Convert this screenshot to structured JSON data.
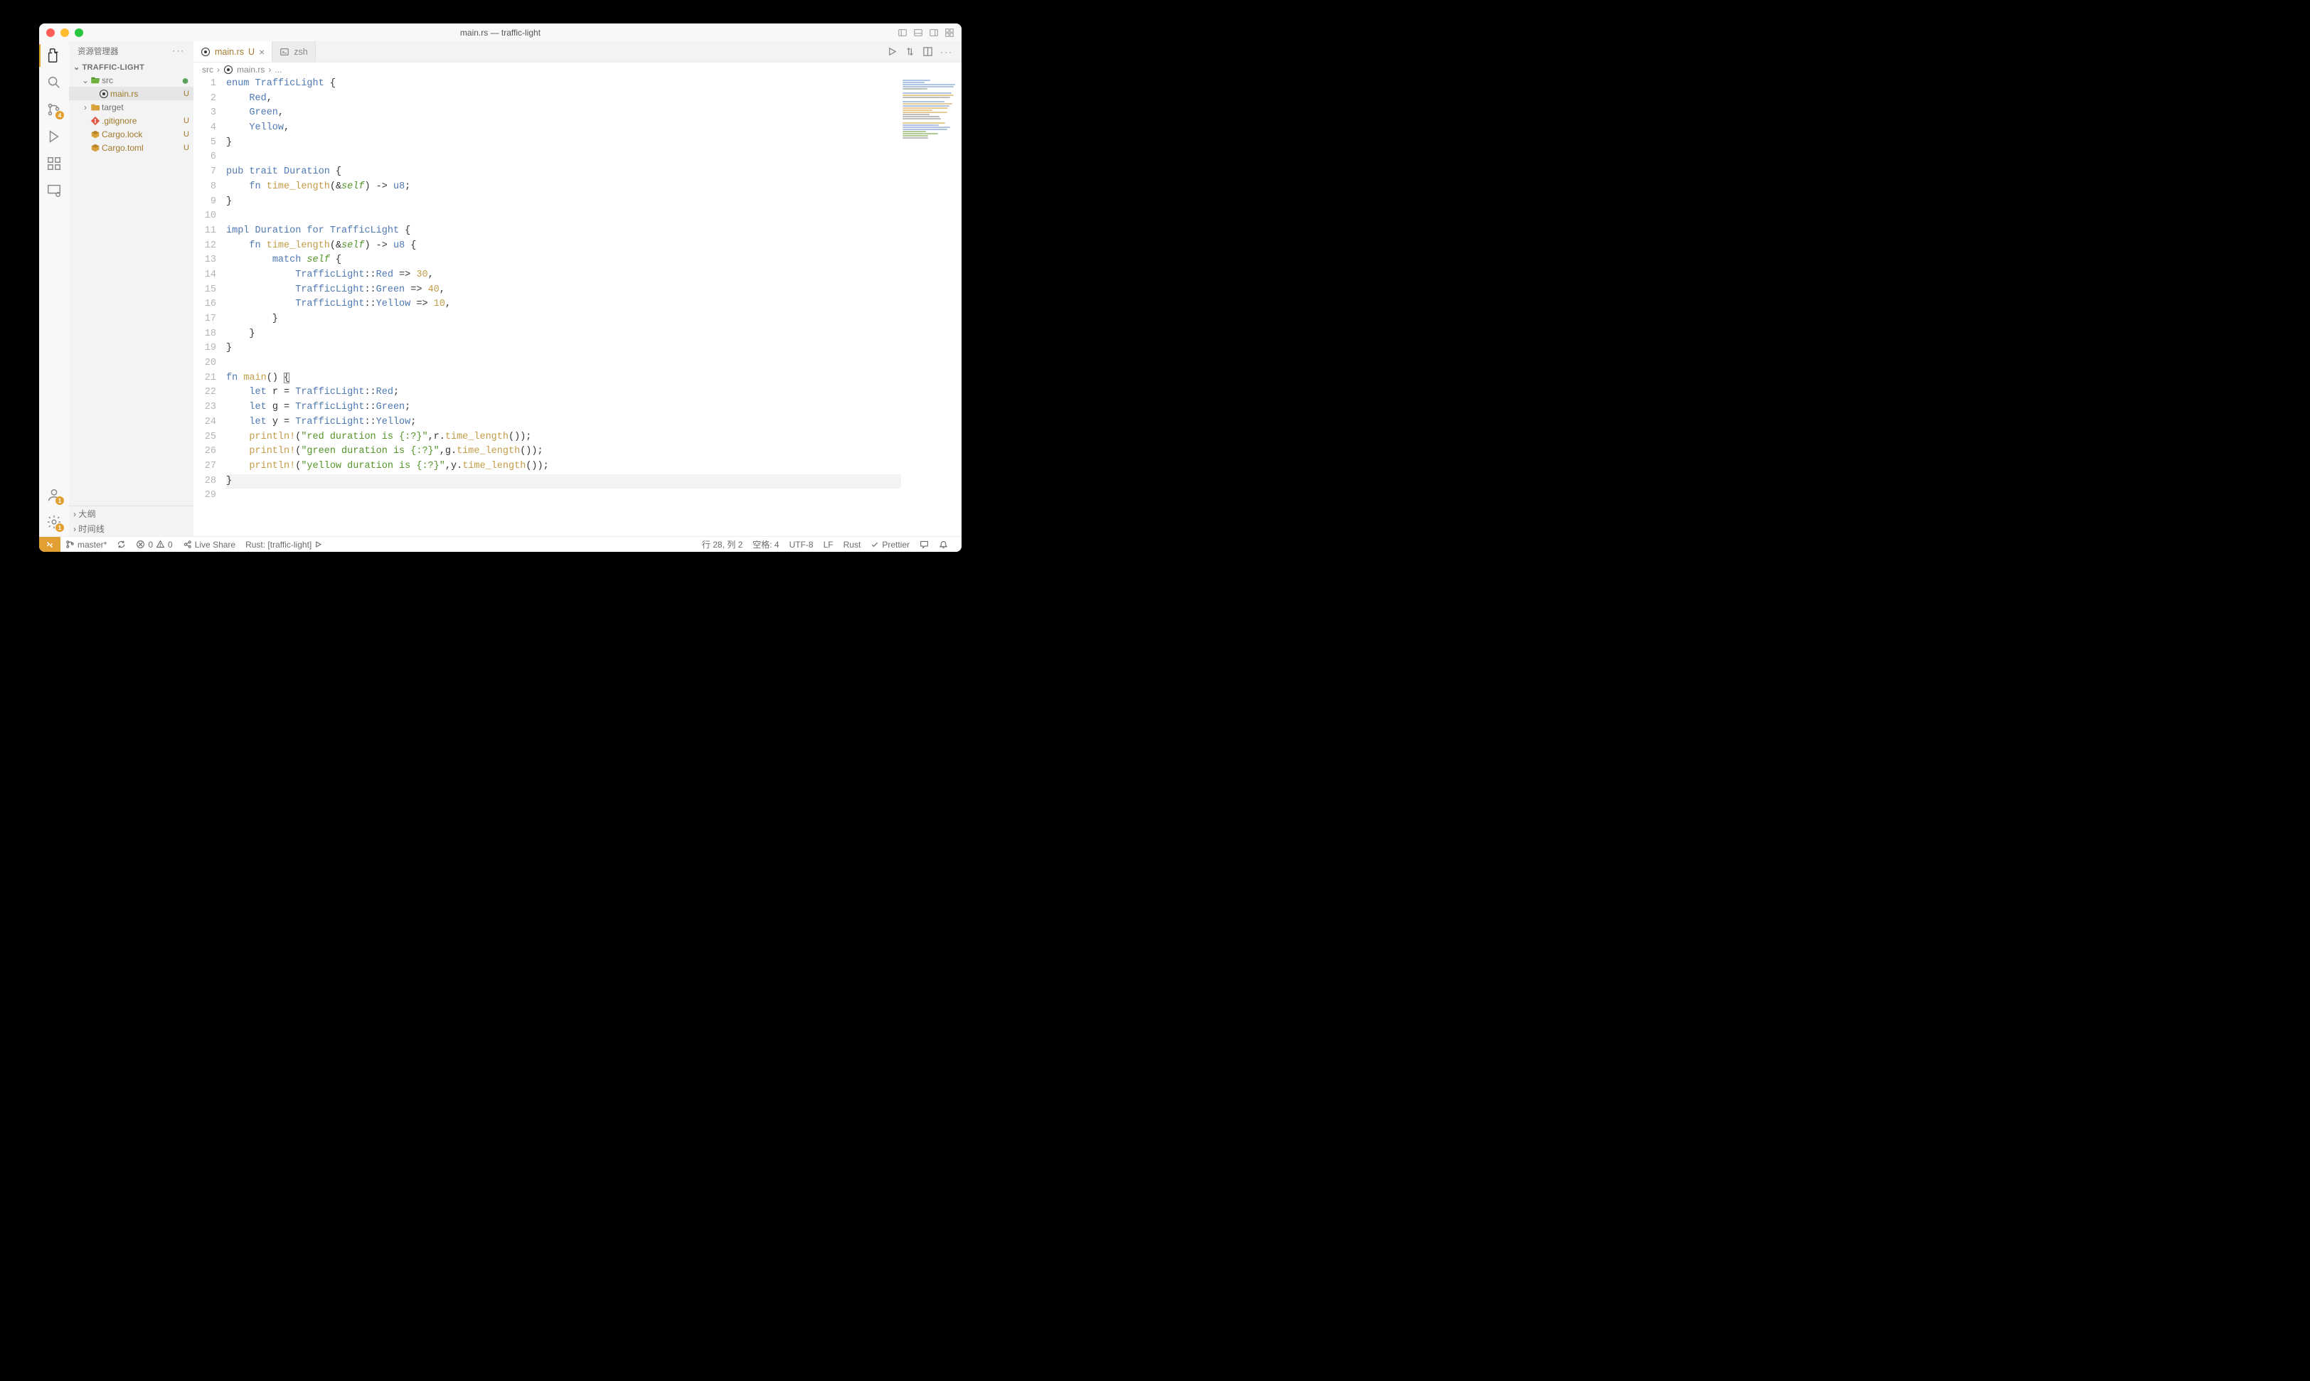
{
  "title": "main.rs — traffic-light",
  "sidebar": {
    "title": "资源管理器",
    "root": "TRAFFIC-LIGHT",
    "items": [
      {
        "label": "src",
        "depth": 1,
        "folder": true,
        "open": true,
        "dot": true,
        "status": ""
      },
      {
        "label": "main.rs",
        "depth": 2,
        "folder": false,
        "selected": true,
        "status": "U",
        "icon": "rust"
      },
      {
        "label": "target",
        "depth": 1,
        "folder": true,
        "open": false,
        "status": ""
      },
      {
        "label": ".gitignore",
        "depth": 1,
        "folder": false,
        "status": "U",
        "icon": "git"
      },
      {
        "label": "Cargo.lock",
        "depth": 1,
        "folder": false,
        "status": "U",
        "icon": "cargo"
      },
      {
        "label": "Cargo.toml",
        "depth": 1,
        "folder": false,
        "status": "U",
        "icon": "cargo"
      }
    ],
    "outline": "大纲",
    "timeline": "时间线"
  },
  "tabs": [
    {
      "label": "main.rs",
      "status": "U",
      "active": true,
      "icon": "rust"
    },
    {
      "label": "zsh",
      "active": false,
      "icon": "shell"
    }
  ],
  "breadcrumb": {
    "a": "src",
    "b": "main.rs",
    "c": "..."
  },
  "activitybar": {
    "scm_badge": "4",
    "settings_badge": "1",
    "account_badge": "1"
  },
  "code": {
    "lines": [
      [
        {
          "t": "enum ",
          "c": "tok-kw"
        },
        {
          "t": "TrafficLight",
          "c": "tok-type"
        },
        {
          "t": " {",
          "c": "tok-punc"
        }
      ],
      [
        {
          "t": "    ",
          "c": ""
        },
        {
          "t": "Red",
          "c": "tok-variant"
        },
        {
          "t": ",",
          "c": "tok-punc"
        }
      ],
      [
        {
          "t": "    ",
          "c": ""
        },
        {
          "t": "Green",
          "c": "tok-variant"
        },
        {
          "t": ",",
          "c": "tok-punc"
        }
      ],
      [
        {
          "t": "    ",
          "c": ""
        },
        {
          "t": "Yellow",
          "c": "tok-variant"
        },
        {
          "t": ",",
          "c": "tok-punc"
        }
      ],
      [
        {
          "t": "}",
          "c": "tok-punc"
        }
      ],
      [],
      [
        {
          "t": "pub ",
          "c": "tok-kw"
        },
        {
          "t": "trait ",
          "c": "tok-kw"
        },
        {
          "t": "Duration",
          "c": "tok-type"
        },
        {
          "t": " {",
          "c": "tok-punc"
        }
      ],
      [
        {
          "t": "    ",
          "c": ""
        },
        {
          "t": "fn ",
          "c": "tok-kw"
        },
        {
          "t": "time_length",
          "c": "tok-fn"
        },
        {
          "t": "(&",
          "c": "tok-punc"
        },
        {
          "t": "self",
          "c": "tok-self"
        },
        {
          "t": ") -> ",
          "c": "tok-punc"
        },
        {
          "t": "u8",
          "c": "tok-type"
        },
        {
          "t": ";",
          "c": "tok-punc"
        }
      ],
      [
        {
          "t": "}",
          "c": "tok-punc"
        }
      ],
      [],
      [
        {
          "t": "impl ",
          "c": "tok-kw"
        },
        {
          "t": "Duration",
          "c": "tok-type"
        },
        {
          "t": " for ",
          "c": "tok-kw"
        },
        {
          "t": "TrafficLight",
          "c": "tok-type"
        },
        {
          "t": " {",
          "c": "tok-punc"
        }
      ],
      [
        {
          "t": "    ",
          "c": ""
        },
        {
          "t": "fn ",
          "c": "tok-kw"
        },
        {
          "t": "time_length",
          "c": "tok-fn"
        },
        {
          "t": "(&",
          "c": "tok-punc"
        },
        {
          "t": "self",
          "c": "tok-self"
        },
        {
          "t": ") -> ",
          "c": "tok-punc"
        },
        {
          "t": "u8",
          "c": "tok-type"
        },
        {
          "t": " {",
          "c": "tok-punc"
        }
      ],
      [
        {
          "t": "        ",
          "c": ""
        },
        {
          "t": "match ",
          "c": "tok-kw"
        },
        {
          "t": "self",
          "c": "tok-self"
        },
        {
          "t": " {",
          "c": "tok-punc"
        }
      ],
      [
        {
          "t": "            ",
          "c": ""
        },
        {
          "t": "TrafficLight",
          "c": "tok-type"
        },
        {
          "t": "::",
          "c": "tok-punc"
        },
        {
          "t": "Red",
          "c": "tok-variant"
        },
        {
          "t": " => ",
          "c": "tok-punc"
        },
        {
          "t": "30",
          "c": "tok-num"
        },
        {
          "t": ",",
          "c": "tok-punc"
        }
      ],
      [
        {
          "t": "            ",
          "c": ""
        },
        {
          "t": "TrafficLight",
          "c": "tok-type"
        },
        {
          "t": "::",
          "c": "tok-punc"
        },
        {
          "t": "Green",
          "c": "tok-variant"
        },
        {
          "t": " => ",
          "c": "tok-punc"
        },
        {
          "t": "40",
          "c": "tok-num"
        },
        {
          "t": ",",
          "c": "tok-punc"
        }
      ],
      [
        {
          "t": "            ",
          "c": ""
        },
        {
          "t": "TrafficLight",
          "c": "tok-type"
        },
        {
          "t": "::",
          "c": "tok-punc"
        },
        {
          "t": "Yellow",
          "c": "tok-variant"
        },
        {
          "t": " => ",
          "c": "tok-punc"
        },
        {
          "t": "10",
          "c": "tok-num"
        },
        {
          "t": ",",
          "c": "tok-punc"
        }
      ],
      [
        {
          "t": "        }",
          "c": "tok-punc"
        }
      ],
      [
        {
          "t": "    }",
          "c": "tok-punc"
        }
      ],
      [
        {
          "t": "}",
          "c": "tok-punc"
        }
      ],
      [],
      [
        {
          "t": "fn ",
          "c": "tok-kw"
        },
        {
          "t": "main",
          "c": "tok-fn"
        },
        {
          "t": "() ",
          "c": "tok-punc"
        },
        {
          "t": "{",
          "c": "tok-punc",
          "box": true
        }
      ],
      [
        {
          "t": "    ",
          "c": ""
        },
        {
          "t": "let ",
          "c": "tok-kw"
        },
        {
          "t": "r = ",
          "c": "tok-op"
        },
        {
          "t": "TrafficLight",
          "c": "tok-type"
        },
        {
          "t": "::",
          "c": "tok-punc"
        },
        {
          "t": "Red",
          "c": "tok-variant"
        },
        {
          "t": ";",
          "c": "tok-punc"
        }
      ],
      [
        {
          "t": "    ",
          "c": ""
        },
        {
          "t": "let ",
          "c": "tok-kw"
        },
        {
          "t": "g = ",
          "c": "tok-op"
        },
        {
          "t": "TrafficLight",
          "c": "tok-type"
        },
        {
          "t": "::",
          "c": "tok-punc"
        },
        {
          "t": "Green",
          "c": "tok-variant"
        },
        {
          "t": ";",
          "c": "tok-punc"
        }
      ],
      [
        {
          "t": "    ",
          "c": ""
        },
        {
          "t": "let ",
          "c": "tok-kw"
        },
        {
          "t": "y = ",
          "c": "tok-op"
        },
        {
          "t": "TrafficLight",
          "c": "tok-type"
        },
        {
          "t": "::",
          "c": "tok-punc"
        },
        {
          "t": "Yellow",
          "c": "tok-variant"
        },
        {
          "t": ";",
          "c": "tok-punc"
        }
      ],
      [
        {
          "t": "    ",
          "c": ""
        },
        {
          "t": "println!",
          "c": "tok-call"
        },
        {
          "t": "(",
          "c": "tok-punc"
        },
        {
          "t": "\"red duration is {:?}\"",
          "c": "tok-str"
        },
        {
          "t": ",r.",
          "c": "tok-punc"
        },
        {
          "t": "time_length",
          "c": "tok-call"
        },
        {
          "t": "());",
          "c": "tok-punc"
        }
      ],
      [
        {
          "t": "    ",
          "c": ""
        },
        {
          "t": "println!",
          "c": "tok-call"
        },
        {
          "t": "(",
          "c": "tok-punc"
        },
        {
          "t": "\"green duration is {:?}\"",
          "c": "tok-str"
        },
        {
          "t": ",g.",
          "c": "tok-punc"
        },
        {
          "t": "time_length",
          "c": "tok-call"
        },
        {
          "t": "());",
          "c": "tok-punc"
        }
      ],
      [
        {
          "t": "    ",
          "c": ""
        },
        {
          "t": "println!",
          "c": "tok-call"
        },
        {
          "t": "(",
          "c": "tok-punc"
        },
        {
          "t": "\"yellow duration is {:?}\"",
          "c": "tok-str"
        },
        {
          "t": ",y.",
          "c": "tok-punc"
        },
        {
          "t": "time_length",
          "c": "tok-call"
        },
        {
          "t": "());",
          "c": "tok-punc"
        }
      ],
      [
        {
          "t": "}",
          "c": "tok-punc"
        }
      ],
      []
    ],
    "highlight_line": 28
  },
  "statusbar": {
    "branch": "master*",
    "errors": "0",
    "warnings": "0",
    "liveshare": "Live Share",
    "rust": "Rust: [traffic-light]",
    "lncol": "行 28, 列 2",
    "spaces": "空格: 4",
    "encoding": "UTF-8",
    "eol": "LF",
    "lang": "Rust",
    "format": "Prettier"
  }
}
